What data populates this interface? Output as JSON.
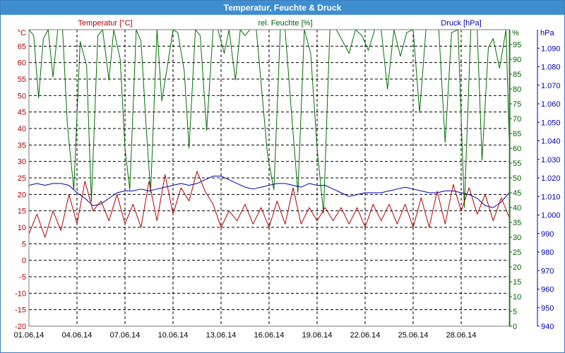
{
  "window": {
    "title": "Temperatur, Feuchte & Druck"
  },
  "chart_data": {
    "type": "line",
    "title": "Temperatur, Feuchte & Druck",
    "grid": true,
    "x": {
      "range": [
        "01.06.14",
        "01.07.14"
      ],
      "tick_labels": [
        "01.06.14",
        "04.06.14",
        "07.06.14",
        "10.06.14",
        "13.06.14",
        "16.06.14",
        "19.06.14",
        "22.06.14",
        "25.06.14",
        "28.06.14"
      ]
    },
    "axes": {
      "temperature": {
        "label": "Temperatur [°C]",
        "unit": "°C",
        "range": [
          -20,
          70
        ],
        "color": "#b00000",
        "ticks": [
          -20,
          -15,
          -10,
          -5,
          0,
          5,
          10,
          15,
          20,
          25,
          30,
          35,
          40,
          45,
          50,
          55,
          60,
          65
        ]
      },
      "humidity": {
        "label": "rel. Feuchte [%]",
        "unit": "%",
        "range": [
          0,
          100
        ],
        "color": "#006400",
        "ticks": [
          0,
          5,
          10,
          15,
          20,
          25,
          30,
          35,
          40,
          45,
          50,
          55,
          60,
          65,
          70,
          75,
          80,
          85,
          90,
          95
        ]
      },
      "pressure": {
        "label": "Druck [hPa]",
        "unit": "hPa",
        "range": [
          940,
          1100
        ],
        "color": "#0000b0",
        "ticks": [
          940,
          950,
          960,
          970,
          980,
          990,
          1000,
          1010,
          1020,
          1030,
          1040,
          1050,
          1060,
          1070,
          1080,
          1090
        ],
        "tick_labels": [
          "940",
          "950",
          "960",
          "970",
          "980",
          "990",
          "1.000",
          "1.010",
          "1.020",
          "1.030",
          "1.040",
          "1.050",
          "1.060",
          "1.070",
          "1.080",
          "1.090"
        ]
      }
    },
    "series": [
      {
        "name": "Temperatur [°C]",
        "axis": "temperature",
        "color": "#b00000",
        "points": [
          [
            0,
            8
          ],
          [
            0.5,
            14
          ],
          [
            1,
            7
          ],
          [
            1.5,
            15
          ],
          [
            2,
            9
          ],
          [
            2.5,
            20
          ],
          [
            3,
            11
          ],
          [
            3.5,
            24
          ],
          [
            4,
            15
          ],
          [
            4.5,
            18
          ],
          [
            5,
            12
          ],
          [
            5.5,
            20
          ],
          [
            6,
            11
          ],
          [
            6.5,
            17
          ],
          [
            7,
            10
          ],
          [
            7.5,
            24
          ],
          [
            8,
            12
          ],
          [
            8.5,
            26
          ],
          [
            9,
            14
          ],
          [
            9.5,
            22
          ],
          [
            10,
            18
          ],
          [
            10.5,
            27
          ],
          [
            11,
            21
          ],
          [
            11.5,
            17
          ],
          [
            12,
            10
          ],
          [
            12.5,
            15
          ],
          [
            13,
            12
          ],
          [
            13.5,
            17
          ],
          [
            14,
            11
          ],
          [
            14.5,
            16
          ],
          [
            15,
            10
          ],
          [
            15.5,
            18
          ],
          [
            16,
            11
          ],
          [
            16.5,
            22
          ],
          [
            17,
            11
          ],
          [
            17.5,
            16
          ],
          [
            18,
            12
          ],
          [
            18.5,
            16
          ],
          [
            19,
            12
          ],
          [
            19.5,
            16
          ],
          [
            20,
            11
          ],
          [
            20.5,
            16
          ],
          [
            21,
            10
          ],
          [
            21.5,
            17
          ],
          [
            22,
            12
          ],
          [
            22.5,
            17
          ],
          [
            23,
            11
          ],
          [
            23.5,
            17
          ],
          [
            24,
            10
          ],
          [
            24.5,
            19
          ],
          [
            25,
            10
          ],
          [
            25.5,
            21
          ],
          [
            26,
            11
          ],
          [
            26.5,
            23
          ],
          [
            27,
            15
          ],
          [
            27.5,
            22
          ],
          [
            28,
            14
          ],
          [
            28.5,
            20
          ],
          [
            29,
            12
          ],
          [
            29.5,
            19
          ],
          [
            30,
            13
          ]
        ]
      },
      {
        "name": "rel. Feuchte [%]",
        "axis": "humidity",
        "color": "#007000",
        "points": [
          [
            0,
            100
          ],
          [
            0.3,
            98
          ],
          [
            0.6,
            77
          ],
          [
            0.9,
            97
          ],
          [
            1.2,
            100
          ],
          [
            1.5,
            84
          ],
          [
            1.8,
            100
          ],
          [
            2.1,
            100
          ],
          [
            2.4,
            68
          ],
          [
            2.8,
            46
          ],
          [
            3.2,
            96
          ],
          [
            3.6,
            88
          ],
          [
            3.9,
            42
          ],
          [
            4.3,
            98
          ],
          [
            4.6,
            100
          ],
          [
            5,
            83
          ],
          [
            5.3,
            100
          ],
          [
            5.7,
            90
          ],
          [
            6,
            60
          ],
          [
            6.3,
            46
          ],
          [
            6.7,
            100
          ],
          [
            7,
            96
          ],
          [
            7.3,
            69
          ],
          [
            7.6,
            45
          ],
          [
            8,
            100
          ],
          [
            8.3,
            76
          ],
          [
            8.6,
            86
          ],
          [
            9,
            100
          ],
          [
            9.3,
            99
          ],
          [
            9.7,
            86
          ],
          [
            10,
            60
          ],
          [
            10.4,
            100
          ],
          [
            10.7,
            98
          ],
          [
            11.1,
            66
          ],
          [
            11.5,
            100
          ],
          [
            11.8,
            100
          ],
          [
            12.2,
            92
          ],
          [
            12.5,
            100
          ],
          [
            12.9,
            83
          ],
          [
            13.2,
            100
          ],
          [
            13.5,
            98
          ],
          [
            13.8,
            100
          ],
          [
            14.2,
            100
          ],
          [
            14.5,
            82
          ],
          [
            14.9,
            58
          ],
          [
            15.3,
            46
          ],
          [
            15.7,
            100
          ],
          [
            16,
            100
          ],
          [
            16.4,
            72
          ],
          [
            16.8,
            45
          ],
          [
            17.2,
            100
          ],
          [
            17.6,
            92
          ],
          [
            18,
            60
          ],
          [
            18.4,
            38
          ],
          [
            18.8,
            100
          ],
          [
            19.2,
            100
          ],
          [
            19.6,
            96
          ],
          [
            20,
            92
          ],
          [
            20.4,
            100
          ],
          [
            20.8,
            98
          ],
          [
            21.2,
            93
          ],
          [
            21.6,
            100
          ],
          [
            22,
            100
          ],
          [
            22.4,
            80
          ],
          [
            22.8,
            100
          ],
          [
            23.2,
            91
          ],
          [
            23.6,
            99
          ],
          [
            24,
            100
          ],
          [
            24.4,
            72
          ],
          [
            24.8,
            100
          ],
          [
            25.2,
            100
          ],
          [
            25.6,
            100
          ],
          [
            26,
            62
          ],
          [
            26.4,
            99
          ],
          [
            26.8,
            100
          ],
          [
            27.2,
            40
          ],
          [
            27.6,
            100
          ],
          [
            28,
            100
          ],
          [
            28.3,
            56
          ],
          [
            28.7,
            94
          ],
          [
            29,
            97
          ],
          [
            29.4,
            87
          ],
          [
            29.8,
            100
          ],
          [
            30,
            62
          ]
        ]
      },
      {
        "name": "Druck [hPa]",
        "axis": "pressure",
        "color": "#0000b0",
        "points": [
          [
            0,
            1016
          ],
          [
            0.5,
            1017
          ],
          [
            1,
            1016
          ],
          [
            1.5,
            1017
          ],
          [
            2,
            1017
          ],
          [
            2.5,
            1016
          ],
          [
            3,
            1012
          ],
          [
            3.5,
            1009
          ],
          [
            4,
            1005
          ],
          [
            4.5,
            1006
          ],
          [
            5,
            1009
          ],
          [
            5.5,
            1012
          ],
          [
            6,
            1013
          ],
          [
            6.5,
            1013
          ],
          [
            7,
            1014
          ],
          [
            7.5,
            1013
          ],
          [
            8,
            1014
          ],
          [
            8.5,
            1015
          ],
          [
            9,
            1016
          ],
          [
            9.5,
            1017
          ],
          [
            10,
            1016
          ],
          [
            10.5,
            1017
          ],
          [
            11,
            1019
          ],
          [
            11.5,
            1021
          ],
          [
            12,
            1021
          ],
          [
            12.5,
            1019
          ],
          [
            13,
            1017
          ],
          [
            13.5,
            1015
          ],
          [
            14,
            1014
          ],
          [
            14.5,
            1015
          ],
          [
            15,
            1016
          ],
          [
            15.5,
            1017
          ],
          [
            16,
            1017
          ],
          [
            16.5,
            1016
          ],
          [
            17,
            1015
          ],
          [
            17.5,
            1017
          ],
          [
            18,
            1016
          ],
          [
            18.5,
            1016
          ],
          [
            19,
            1014
          ],
          [
            19.5,
            1012
          ],
          [
            20,
            1010
          ],
          [
            20.5,
            1011
          ],
          [
            21,
            1012
          ],
          [
            21.5,
            1012
          ],
          [
            22,
            1012
          ],
          [
            22.5,
            1013
          ],
          [
            23,
            1014
          ],
          [
            23.5,
            1015
          ],
          [
            24,
            1014
          ],
          [
            24.5,
            1013
          ],
          [
            25,
            1012
          ],
          [
            25.5,
            1012
          ],
          [
            26,
            1013
          ],
          [
            26.5,
            1013
          ],
          [
            27,
            1012
          ],
          [
            27.5,
            1011
          ],
          [
            28,
            1009
          ],
          [
            28.5,
            1005
          ],
          [
            29,
            1004
          ],
          [
            29.5,
            1007
          ],
          [
            30,
            1012
          ]
        ]
      }
    ]
  }
}
